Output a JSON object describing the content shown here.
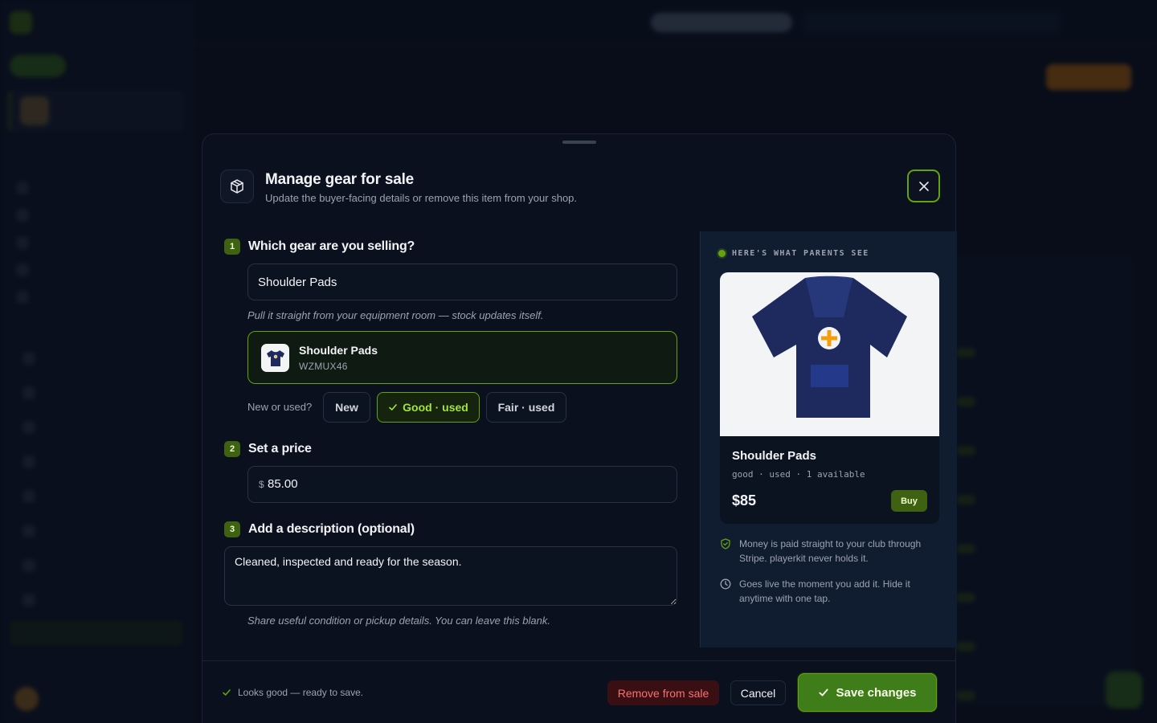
{
  "modal": {
    "title": "Manage gear for sale",
    "subtitle": "Update the buyer-facing details or remove this item from your shop."
  },
  "steps": {
    "gear": {
      "number": "1",
      "label": "Which gear are you selling?"
    },
    "price": {
      "number": "2",
      "label": "Set a price"
    },
    "description": {
      "number": "3",
      "label": "Add a description (optional)"
    }
  },
  "gear_search": {
    "value": "Shoulder Pads",
    "hint": "Pull it straight from your equipment room — stock updates itself."
  },
  "selected_gear": {
    "name": "Shoulder Pads",
    "sku": "WZMUX46",
    "thumb_icon": "jersey-icon"
  },
  "condition": {
    "label": "New or used?",
    "options": [
      "New",
      "Good · used",
      "Fair · used"
    ],
    "selected": "Good · used"
  },
  "price": {
    "currency_symbol": "$",
    "value": "85.00"
  },
  "description": {
    "value": "Cleaned, inspected and ready for the season.",
    "hint": "Share useful condition or pickup details. You can leave this blank."
  },
  "preview": {
    "label": "HERE'S WHAT PARENTS SEE",
    "card": {
      "name": "Shoulder Pads",
      "meta": "good · used · 1 available",
      "price": "$85",
      "buy_label": "Buy"
    },
    "info": [
      {
        "icon": "shield-check-icon",
        "text": "Money is paid straight to your club through Stripe. playerkit never holds it."
      },
      {
        "icon": "clock-icon",
        "text": "Goes live the moment you add it. Hide it anytime with one tap."
      }
    ]
  },
  "footer": {
    "status": "Looks good — ready to save.",
    "remove_label": "Remove from sale",
    "cancel_label": "Cancel",
    "save_label": "Save changes"
  },
  "colors": {
    "accent": "#65a30d",
    "accent_dark": "#3f7c1a",
    "danger": "#f87171",
    "jersey": "#1e2a5e",
    "jersey_emblem": "#f59e0b"
  }
}
